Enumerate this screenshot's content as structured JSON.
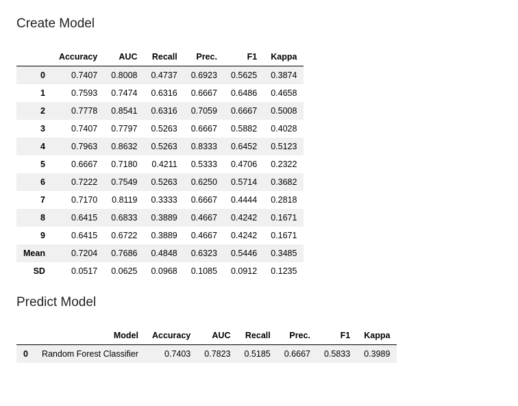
{
  "sections": {
    "create": {
      "title": "Create Model"
    },
    "predict": {
      "title": "Predict Model"
    }
  },
  "create_table": {
    "headers": {
      "idx": "",
      "acc": "Accuracy",
      "auc": "AUC",
      "recall": "Recall",
      "prec": "Prec.",
      "f1": "F1",
      "kappa": "Kappa"
    },
    "rows": [
      {
        "idx": "0",
        "acc": "0.7407",
        "auc": "0.8008",
        "recall": "0.4737",
        "prec": "0.6923",
        "f1": "0.5625",
        "kappa": "0.3874"
      },
      {
        "idx": "1",
        "acc": "0.7593",
        "auc": "0.7474",
        "recall": "0.6316",
        "prec": "0.6667",
        "f1": "0.6486",
        "kappa": "0.4658"
      },
      {
        "idx": "2",
        "acc": "0.7778",
        "auc": "0.8541",
        "recall": "0.6316",
        "prec": "0.7059",
        "f1": "0.6667",
        "kappa": "0.5008"
      },
      {
        "idx": "3",
        "acc": "0.7407",
        "auc": "0.7797",
        "recall": "0.5263",
        "prec": "0.6667",
        "f1": "0.5882",
        "kappa": "0.4028"
      },
      {
        "idx": "4",
        "acc": "0.7963",
        "auc": "0.8632",
        "recall": "0.5263",
        "prec": "0.8333",
        "f1": "0.6452",
        "kappa": "0.5123"
      },
      {
        "idx": "5",
        "acc": "0.6667",
        "auc": "0.7180",
        "recall": "0.4211",
        "prec": "0.5333",
        "f1": "0.4706",
        "kappa": "0.2322"
      },
      {
        "idx": "6",
        "acc": "0.7222",
        "auc": "0.7549",
        "recall": "0.5263",
        "prec": "0.6250",
        "f1": "0.5714",
        "kappa": "0.3682"
      },
      {
        "idx": "7",
        "acc": "0.7170",
        "auc": "0.8119",
        "recall": "0.3333",
        "prec": "0.6667",
        "f1": "0.4444",
        "kappa": "0.2818"
      },
      {
        "idx": "8",
        "acc": "0.6415",
        "auc": "0.6833",
        "recall": "0.3889",
        "prec": "0.4667",
        "f1": "0.4242",
        "kappa": "0.1671"
      },
      {
        "idx": "9",
        "acc": "0.6415",
        "auc": "0.6722",
        "recall": "0.3889",
        "prec": "0.4667",
        "f1": "0.4242",
        "kappa": "0.1671"
      },
      {
        "idx": "Mean",
        "acc": "0.7204",
        "auc": "0.7686",
        "recall": "0.4848",
        "prec": "0.6323",
        "f1": "0.5446",
        "kappa": "0.3485"
      },
      {
        "idx": "SD",
        "acc": "0.0517",
        "auc": "0.0625",
        "recall": "0.0968",
        "prec": "0.1085",
        "f1": "0.0912",
        "kappa": "0.1235"
      }
    ]
  },
  "predict_table": {
    "headers": {
      "idx": "",
      "model": "Model",
      "acc": "Accuracy",
      "auc": "AUC",
      "recall": "Recall",
      "prec": "Prec.",
      "f1": "F1",
      "kappa": "Kappa"
    },
    "rows": [
      {
        "idx": "0",
        "model": "Random Forest Classifier",
        "acc": "0.7403",
        "auc": "0.7823",
        "recall": "0.5185",
        "prec": "0.6667",
        "f1": "0.5833",
        "kappa": "0.3989"
      }
    ]
  }
}
